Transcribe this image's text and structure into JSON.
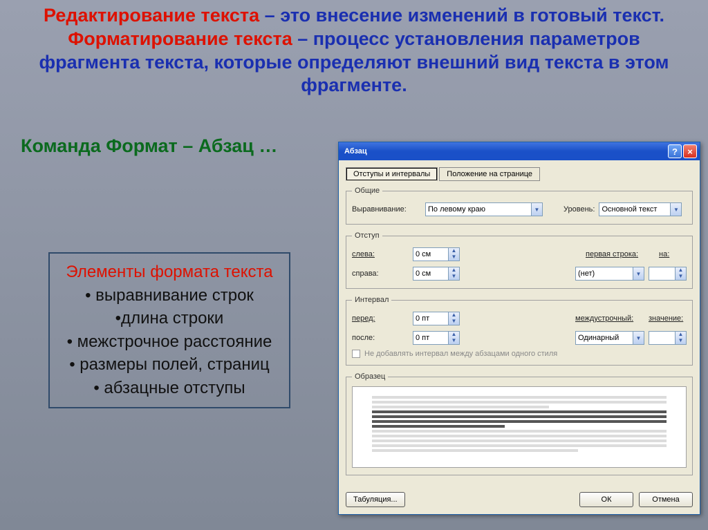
{
  "headline": {
    "part1_red": "Редактирование текста",
    "part1_blue": " – это внесение изменений в готовый текст.",
    "part2_red": "Форматирование текста",
    "part2_blue": " – процесс установления параметров фрагмента текста, которые определяют внешний вид текста в этом фрагменте."
  },
  "subline": "Команда Формат – Абзац …",
  "list": {
    "title": "Элементы формата текста",
    "items": [
      "• выравнивание строк",
      "•длина строки",
      "• межстрочное расстояние",
      "• размеры полей, страниц",
      "• абзацные отступы"
    ]
  },
  "dialog": {
    "title": "Абзац",
    "help": "?",
    "close": "×",
    "tabs": {
      "t1": "Отступы и интервалы",
      "t2": "Положение на странице"
    },
    "general": {
      "legend": "Общие",
      "alignLabel": "Выравнивание:",
      "alignValue": "По левому краю",
      "levelLabel": "Уровень:",
      "levelValue": "Основной текст"
    },
    "indent": {
      "legend": "Отступ",
      "leftLabel": "слева:",
      "leftValue": "0 см",
      "rightLabel": "справа:",
      "rightValue": "0 см",
      "firstLabel": "первая строка:",
      "byLabel": "на:",
      "firstValue": "(нет)"
    },
    "spacing": {
      "legend": "Интервал",
      "beforeLabel": "перед:",
      "beforeValue": "0 пт",
      "afterLabel": "после:",
      "afterValue": "0 пт",
      "lineLabel": "междустрочный:",
      "valLabel": "значение:",
      "lineValue": "Одинарный",
      "checkbox": "Не добавлять интервал между абзацами одного стиля"
    },
    "preview": {
      "legend": "Образец"
    },
    "buttons": {
      "tabs": "Табуляция...",
      "ok": "ОК",
      "cancel": "Отмена"
    }
  }
}
